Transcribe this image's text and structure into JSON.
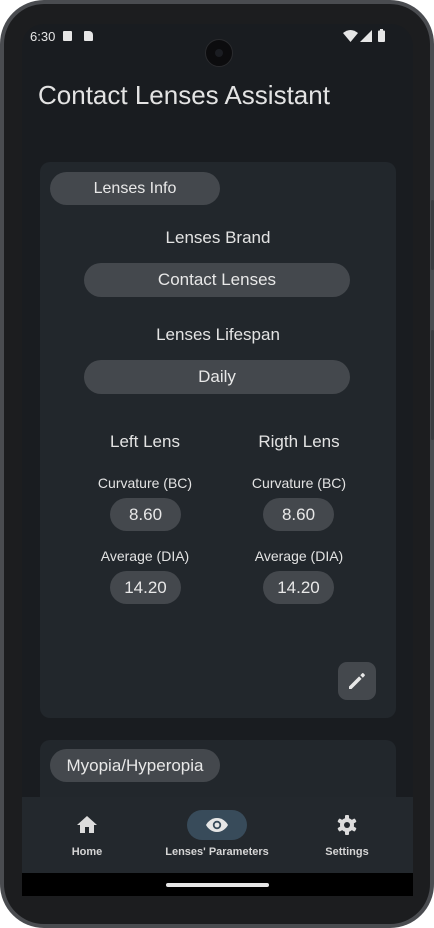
{
  "status_bar": {
    "time": "6:30"
  },
  "app": {
    "title": "Contact Lenses Assistant"
  },
  "lenses_info": {
    "section_label": "Lenses Info",
    "brand_label": "Lenses Brand",
    "brand_value": "Contact Lenses",
    "lifespan_label": "Lenses Lifespan",
    "lifespan_value": "Daily",
    "left": {
      "title": "Left Lens",
      "curvature_label": "Curvature (BC)",
      "curvature_value": "8.60",
      "diameter_label": "Average (DIA)",
      "diameter_value": "14.20"
    },
    "right": {
      "title": "Rigth Lens",
      "curvature_label": "Curvature (BC)",
      "curvature_value": "8.60",
      "diameter_label": "Average (DIA)",
      "diameter_value": "14.20"
    },
    "edit_icon": "pencil-icon"
  },
  "myopia": {
    "section_label": "Myopia/Hyperopia"
  },
  "nav": {
    "items": [
      {
        "label": "Home",
        "icon": "home-icon",
        "active": false
      },
      {
        "label": "Lenses' Parameters",
        "icon": "eye-icon",
        "active": true
      },
      {
        "label": "Settings",
        "icon": "gear-icon",
        "active": false
      }
    ]
  },
  "colors": {
    "background": "#191c20",
    "card": "#22272c",
    "chip": "#44484d",
    "nav_active": "#384b5a"
  }
}
